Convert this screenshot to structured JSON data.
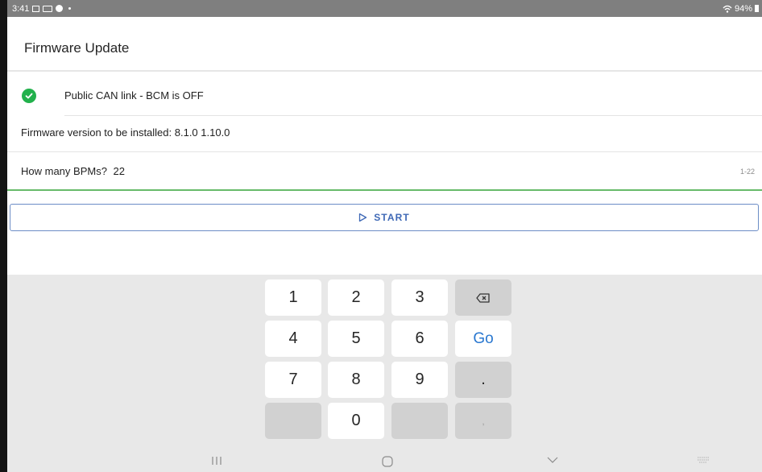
{
  "status_bar": {
    "time": "3:41",
    "battery": "94%"
  },
  "header": {
    "title": "Firmware Update"
  },
  "rows": {
    "link_status": "Public CAN link - BCM is OFF",
    "firmware_version": "Firmware version to be installed: 8.1.0 1.10.0",
    "bpms_prompt": "How many BPMs?",
    "bpms_value": "22",
    "bpms_range": "1-22"
  },
  "start_button": {
    "label": "START"
  },
  "keyboard": {
    "keys": [
      "1",
      "2",
      "3",
      "4",
      "5",
      "6",
      "7",
      "8",
      "9",
      "0"
    ],
    "go": "Go",
    "dot": ".",
    "comma": ","
  },
  "colors": {
    "accent": "#3f69b6",
    "success": "#22b14c",
    "keyboard_bg": "#e8e8e8",
    "status_bar": "#7f7f7f"
  },
  "icons": [
    "check-circle-icon",
    "play-outline-icon",
    "backspace-icon",
    "recents-icon",
    "home-icon",
    "back-icon",
    "keyboard-toggle-icon",
    "wifi-icon",
    "battery-icon"
  ]
}
